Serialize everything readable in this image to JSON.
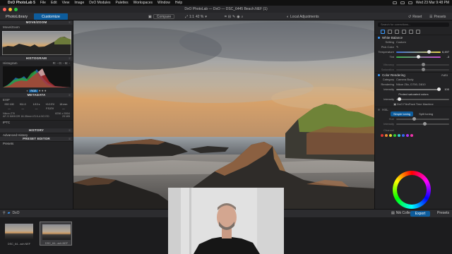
{
  "menubar": {
    "app": "DxO PhotoLab 5",
    "items": [
      "File",
      "Edit",
      "View",
      "Image",
      "DxO Modules",
      "Palettes",
      "Workspaces",
      "Window",
      "Help"
    ],
    "clock": "Wed 23 Mar  9:48 PM"
  },
  "window": {
    "title": "DxO PhotoLab — DxO — DSC_6445 Beach.NEF (1)"
  },
  "toolbar": {
    "tab_library": "PhotoLibrary",
    "tab_customize": "Customize",
    "compare": "Compare",
    "zoom": "42 %",
    "local_adjust": "Local Adjustments",
    "reset": "Reset",
    "presets": "Presets"
  },
  "left": {
    "movezoom_h": "MOVE/ZOOM",
    "movezoom_sub": "Move/Zoom",
    "histogram_h": "HISTOGRAM",
    "histogram_sub": "Histogram",
    "histogram_mode": "RGB",
    "histogram_vals": "R: - G: - B: -",
    "metadata_h": "METADATA",
    "exif_label": "EXIF",
    "exif_row1": [
      "ISO 100",
      "f/11.0",
      "1/13 s",
      "+0.0 EV",
      "18 mm"
    ],
    "exif_row2": [
      "—",
      "—",
      "—",
      "F.S.EV",
      "—"
    ],
    "camera": "Nikon Z7II",
    "lens": "AF-S NIKKOR 18-35mm f/3.5-4.5G ED",
    "dims": "8256 x 5504",
    "size": "29 MB",
    "iptc": "IPTC",
    "history_h": "HISTORY",
    "history_item": "Advanced History",
    "preset_h": "PRESET EDITOR",
    "preset_item": "Presets"
  },
  "right": {
    "search_placeholder": "Search for corrections...",
    "wb_head": "White Balance",
    "wb_setting_lbl": "Setting",
    "wb_setting_val": "Custom",
    "pick_color": "Pick Color",
    "temp_lbl": "Temperature",
    "temp_val": "6,497",
    "tint_lbl": "Tint",
    "tint_val": "-3",
    "vib_lbl": "Vibrancy",
    "sat_lbl": "Saturation",
    "color_render_head": "Color Rendering",
    "auto": "Auto",
    "category_lbl": "Category",
    "category_val": "Camera Body",
    "rendering_lbl": "Rendering",
    "rendering_val": "Nikon Z6x, D750, D810",
    "intensity_lbl": "Intensity",
    "intensity_val": "100",
    "protect": "Protect saturated colors",
    "intensity2_lbl": "Intensity",
    "filmpack": "DxO FilmPack Time Machine",
    "hsl_head": "HSL",
    "simple_toning": "Simple toning",
    "split_toning": "Split toning",
    "intensity3_lbl": "Intensity",
    "hue_lbl": "Hue",
    "channel_lbl": "Channel",
    "wheel_label": "Color wheel"
  },
  "bottom": {
    "folder": "DxO",
    "nik": "Nik Collection",
    "export": "Export",
    "presets": "Presets"
  },
  "filmstrip": [
    {
      "name": "DSC_64...ach.NEF"
    },
    {
      "name": "DSC_64...ach.NEF"
    }
  ],
  "colors": {
    "accent": "#0d5c9c",
    "panel": "#232325",
    "highlight": "#3a9bff"
  }
}
